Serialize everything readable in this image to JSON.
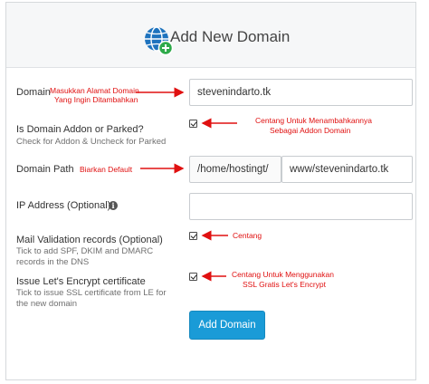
{
  "header": {
    "title": "Add New Domain",
    "icon": "globe-plus-icon"
  },
  "form": {
    "domain": {
      "label": "Domain",
      "value": "stevenindarto.tk"
    },
    "addon": {
      "label": "Is Domain Addon or Parked?",
      "hint": "Check for Addon & Uncheck for Parked",
      "checked": true
    },
    "path": {
      "label": "Domain Path",
      "prefix": "/home/hostingt/",
      "value": "www/stevenindarto.tk"
    },
    "ip": {
      "label": "IP Address (Optional)",
      "value": ""
    },
    "mail": {
      "label": "Mail Validation records (Optional)",
      "hint_line1": "Tick to add SPF, DKIM and DMARC",
      "hint_line2": "records in the DNS",
      "checked": true
    },
    "ssl": {
      "label": "Issue Let's Encrypt certificate",
      "hint_line1": "Tick to issue SSL certificate from LE for",
      "hint_line2": "the new domain",
      "checked": true
    },
    "submit_label": "Add Domain"
  },
  "annotations": {
    "domain_line1": "Masukkan Alamat Domain",
    "domain_line2": "Yang Ingin Ditambahkan",
    "addon_line1": "Centang Untuk Menambahkannya",
    "addon_line2": "Sebagai Addon Domain",
    "path": "Biarkan Default",
    "mail": "Centang",
    "ssl_line1": "Centang Untuk Menggunakan",
    "ssl_line2": "SSL Gratis Let's Encrypt"
  },
  "colors": {
    "accent": "#1a9bd7",
    "annotation": "#e01010",
    "icon_globe": "#1e73be",
    "icon_plus": "#2eaa4a"
  }
}
